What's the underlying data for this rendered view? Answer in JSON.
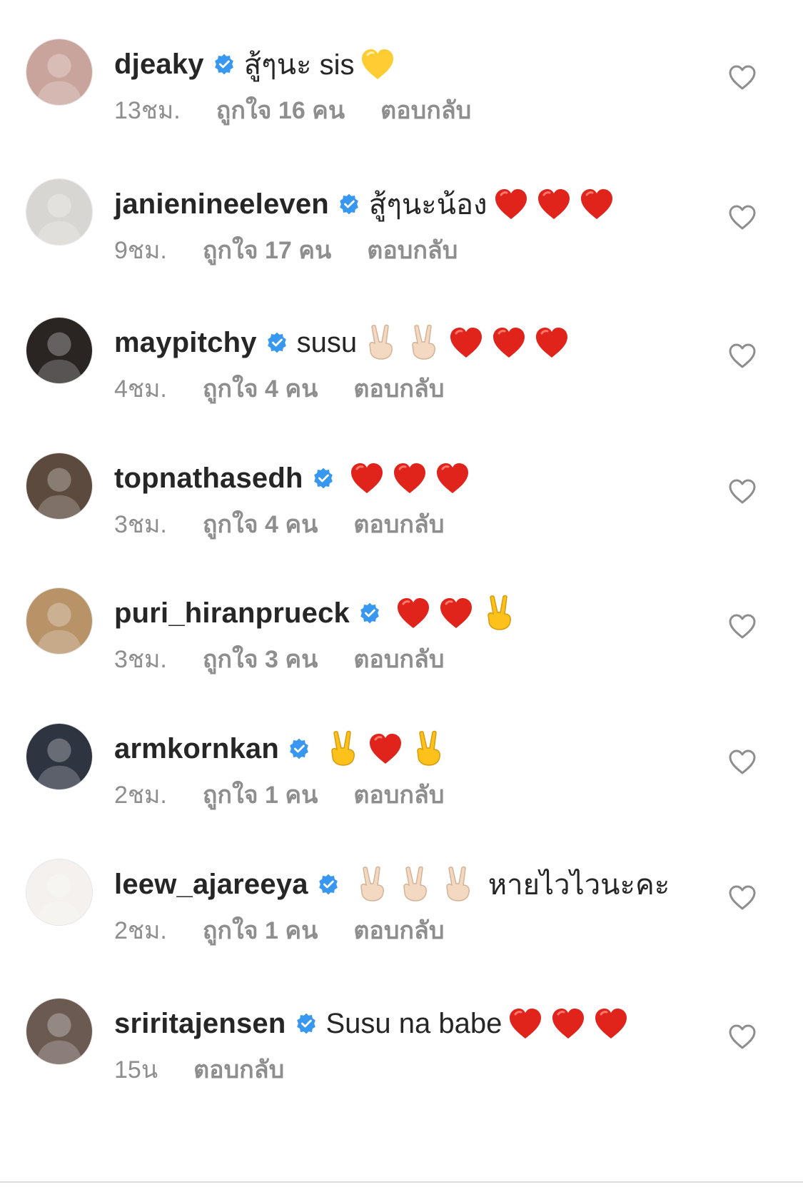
{
  "comments": [
    {
      "username": "djeaky",
      "text": "สู้ๆนะ sis",
      "emojis": [
        "yellow-heart"
      ],
      "time": "13ชม.",
      "likes": "ถูกใจ 16 คน",
      "reply": "ตอบกลับ",
      "avatar_color": "#c9a49c"
    },
    {
      "username": "janienineeleven",
      "text": "สู้ๆนะน้อง",
      "emojis": [
        "red-heart",
        "red-heart",
        "red-heart"
      ],
      "time": "9ชม.",
      "likes": "ถูกใจ 17 คน",
      "reply": "ตอบกลับ",
      "avatar_color": "#d8d6d2"
    },
    {
      "username": "maypitchy",
      "text": "susu",
      "emojis": [
        "victory-hand-light",
        "victory-hand-light",
        "red-heart",
        "red-heart",
        "red-heart"
      ],
      "time": "4ชม.",
      "likes": "ถูกใจ 4 คน",
      "reply": "ตอบกลับ",
      "avatar_color": "#2a2523"
    },
    {
      "username": "topnathasedh",
      "text": "",
      "emojis": [
        "red-heart",
        "red-heart",
        "red-heart"
      ],
      "time": "3ชม.",
      "likes": "ถูกใจ 4 คน",
      "reply": "ตอบกลับ",
      "avatar_color": "#5b4a3d"
    },
    {
      "username": "puri_hiranprueck",
      "text": "",
      "emojis": [
        "red-heart",
        "red-heart",
        "victory-hand-yellow"
      ],
      "time": "3ชม.",
      "likes": "ถูกใจ 3 คน",
      "reply": "ตอบกลับ",
      "avatar_color": "#b89368"
    },
    {
      "username": "armkornkan",
      "text": "",
      "emojis": [
        "victory-hand-yellow",
        "red-heart",
        "victory-hand-yellow"
      ],
      "time": "2ชม.",
      "likes": "ถูกใจ 1 คน",
      "reply": "ตอบกลับ",
      "avatar_color": "#2e3440"
    },
    {
      "username": "leew_ajareeya",
      "text": "หายไวไวนะคะ",
      "emojis_before_text": [
        "victory-hand-light",
        "victory-hand-light",
        "victory-hand-light"
      ],
      "emojis": [],
      "time": "2ชม.",
      "likes": "ถูกใจ 1 คน",
      "reply": "ตอบกลับ",
      "avatar_color": "#f4f1ee"
    },
    {
      "username": "sriritajensen",
      "text": "Susu na babe",
      "emojis": [
        "red-heart",
        "red-heart",
        "red-heart"
      ],
      "time": "15น",
      "likes": "",
      "reply": "ตอบกลับ",
      "avatar_color": "#6b5a52"
    }
  ],
  "colors": {
    "username": "#262626",
    "meta": "#8e8e8e",
    "verified_badge": "#3897f0",
    "like_heart_outline": "#8e8e8e",
    "red_heart": "#e0241b",
    "yellow_heart": "#ffcc33"
  },
  "icons": {
    "verified": "verified-badge-icon",
    "like": "heart-outline-icon"
  }
}
